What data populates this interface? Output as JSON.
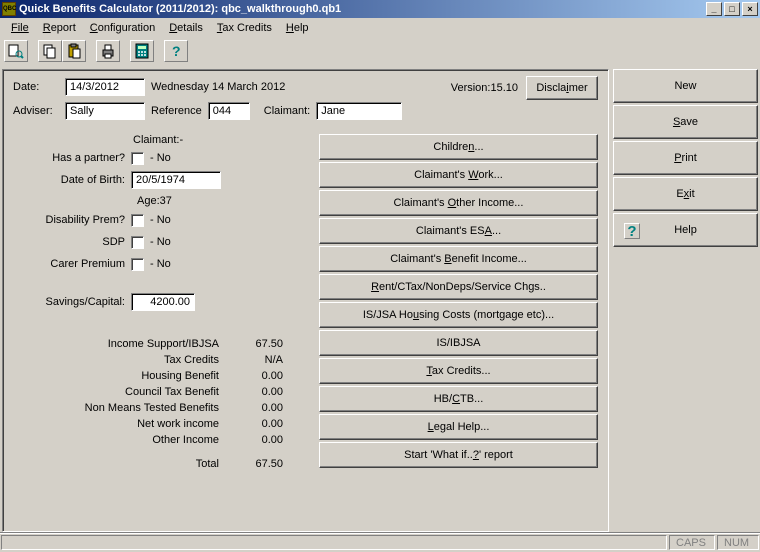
{
  "titlebar": {
    "icon_text": "QBC",
    "title": "Quick Benefits Calculator (2011/2012): qbc_walkthrough0.qb1"
  },
  "menubar": [
    "File",
    "Report",
    "Configuration",
    "Details",
    "Tax Credits",
    "Help"
  ],
  "top": {
    "date_label": "Date:",
    "date_value": "14/3/2012",
    "date_long": "Wednesday 14 March 2012",
    "version_label": "Version:15.10",
    "disclaimer": "Disclaimer",
    "adviser_label": "Adviser:",
    "adviser_value": "Sally",
    "reference_label": "Reference",
    "reference_value": "044",
    "claimant_label": "Claimant:",
    "claimant_value": "Jane"
  },
  "claimant": {
    "heading": "Claimant:-",
    "partner_label": "Has a partner?",
    "partner_text": "- No",
    "dob_label": "Date of Birth:",
    "dob_value": "20/5/1974",
    "age_text": "Age:37",
    "disprem_label": "Disability Prem?",
    "disprem_text": "- No",
    "sdp_label": "SDP",
    "sdp_text": "- No",
    "carer_label": "Carer Premium",
    "carer_text": "- No",
    "savings_label": "Savings/Capital:",
    "savings_value": "4200.00"
  },
  "categories": [
    {
      "pre": "Childre",
      "u": "n",
      "post": "..."
    },
    {
      "pre": "Claimant's ",
      "u": "W",
      "post": "ork..."
    },
    {
      "pre": "Claimant's ",
      "u": "O",
      "post": "ther Income..."
    },
    {
      "pre": "Claimant's ES",
      "u": "A",
      "post": "..."
    },
    {
      "pre": "Claimant's ",
      "u": "B",
      "post": "enefit Income..."
    },
    {
      "pre": "",
      "u": "R",
      "post": "ent/CTax/NonDeps/Service Chgs.."
    },
    {
      "pre": "IS/JSA Ho",
      "u": "u",
      "post": "sing Costs (mortgage etc)..."
    },
    {
      "pre": "IS/IBJSA",
      "u": "",
      "post": ""
    },
    {
      "pre": "",
      "u": "T",
      "post": "ax Credits..."
    },
    {
      "pre": "HB/",
      "u": "C",
      "post": "TB..."
    },
    {
      "pre": "",
      "u": "L",
      "post": "egal Help..."
    },
    {
      "pre": "Start 'What if..",
      "u": "?",
      "post": "' report"
    }
  ],
  "summary": {
    "rows": [
      {
        "name": "Income Support/IBJSA",
        "value": "67.50"
      },
      {
        "name": "Tax Credits",
        "value": "N/A"
      },
      {
        "name": "Housing Benefit",
        "value": "0.00"
      },
      {
        "name": "Council Tax Benefit",
        "value": "0.00"
      },
      {
        "name": "Non Means Tested Benefits",
        "value": "0.00"
      },
      {
        "name": "Net work income",
        "value": "0.00"
      },
      {
        "name": "Other Income",
        "value": "0.00"
      }
    ],
    "total_label": "Total",
    "total_value": "67.50"
  },
  "side": {
    "new": "New",
    "save": "Save",
    "print": "Print",
    "exit": "Exit",
    "help": "Help"
  },
  "status": {
    "caps": "CAPS",
    "num": "NUM"
  }
}
